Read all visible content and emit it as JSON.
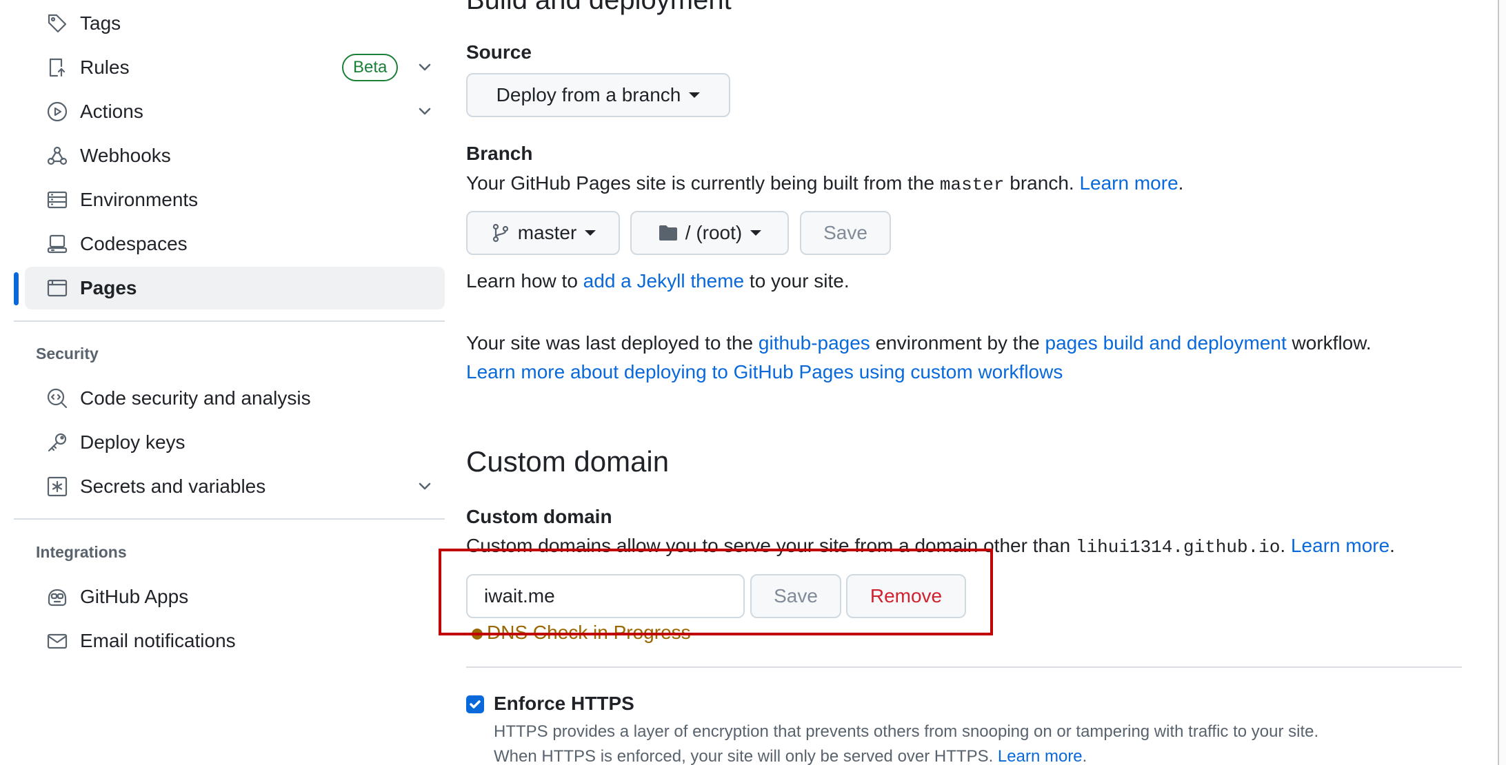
{
  "sidebar": {
    "items": [
      {
        "label": "Tags"
      },
      {
        "label": "Rules",
        "badge": "Beta"
      },
      {
        "label": "Actions"
      },
      {
        "label": "Webhooks"
      },
      {
        "label": "Environments"
      },
      {
        "label": "Codespaces"
      },
      {
        "label": "Pages",
        "active": true
      }
    ],
    "security_title": "Security",
    "security_items": [
      {
        "label": "Code security and analysis"
      },
      {
        "label": "Deploy keys"
      },
      {
        "label": "Secrets and variables"
      }
    ],
    "integrations_title": "Integrations",
    "integrations_items": [
      {
        "label": "GitHub Apps"
      },
      {
        "label": "Email notifications"
      }
    ]
  },
  "main": {
    "build_heading": "Build and deployment",
    "source": {
      "label": "Source",
      "dropdown_value": "Deploy from a branch"
    },
    "branch": {
      "label": "Branch",
      "description_prefix": "Your GitHub Pages site is currently being built from the ",
      "branch_code": "master",
      "description_suffix": " branch. ",
      "learn_more": "Learn more",
      "period": ".",
      "branch_button": "master",
      "folder_button": "/ (root)",
      "save_button": "Save",
      "jekyll_prefix": "Learn how to ",
      "jekyll_link": "add a Jekyll theme",
      "jekyll_suffix": " to your site."
    },
    "deploy": {
      "prefix": "Your site was last deployed to the ",
      "env_link": "github-pages",
      "middle": " environment by the ",
      "workflow_link": "pages build and deployment",
      "suffix": " workflow.",
      "custom_workflows_link": "Learn more about deploying to GitHub Pages using custom workflows"
    },
    "custom_domain": {
      "heading": "Custom domain",
      "label": "Custom domain",
      "description_prefix": "Custom domains allow you to serve your site from a domain other than ",
      "domain_code": "lihui1314.github.io",
      "description_suffix": ". ",
      "learn_more": "Learn more",
      "period": ".",
      "input_value": "iwait.me",
      "save_button": "Save",
      "remove_button": "Remove",
      "dns_status": "DNS Check in Progress"
    },
    "https": {
      "label": "Enforce HTTPS",
      "checked": true,
      "line1": "HTTPS provides a layer of encryption that prevents others from snooping on or tampering with traffic to your site.",
      "line2_prefix": "When HTTPS is enforced, your site will only be served over HTTPS. ",
      "learn_more": "Learn more",
      "period": "."
    }
  },
  "colors": {
    "accent": "#0969da",
    "success": "#1a7f37",
    "danger": "#cf222e",
    "attention": "#9a6700",
    "highlight_box": "#c00000"
  }
}
